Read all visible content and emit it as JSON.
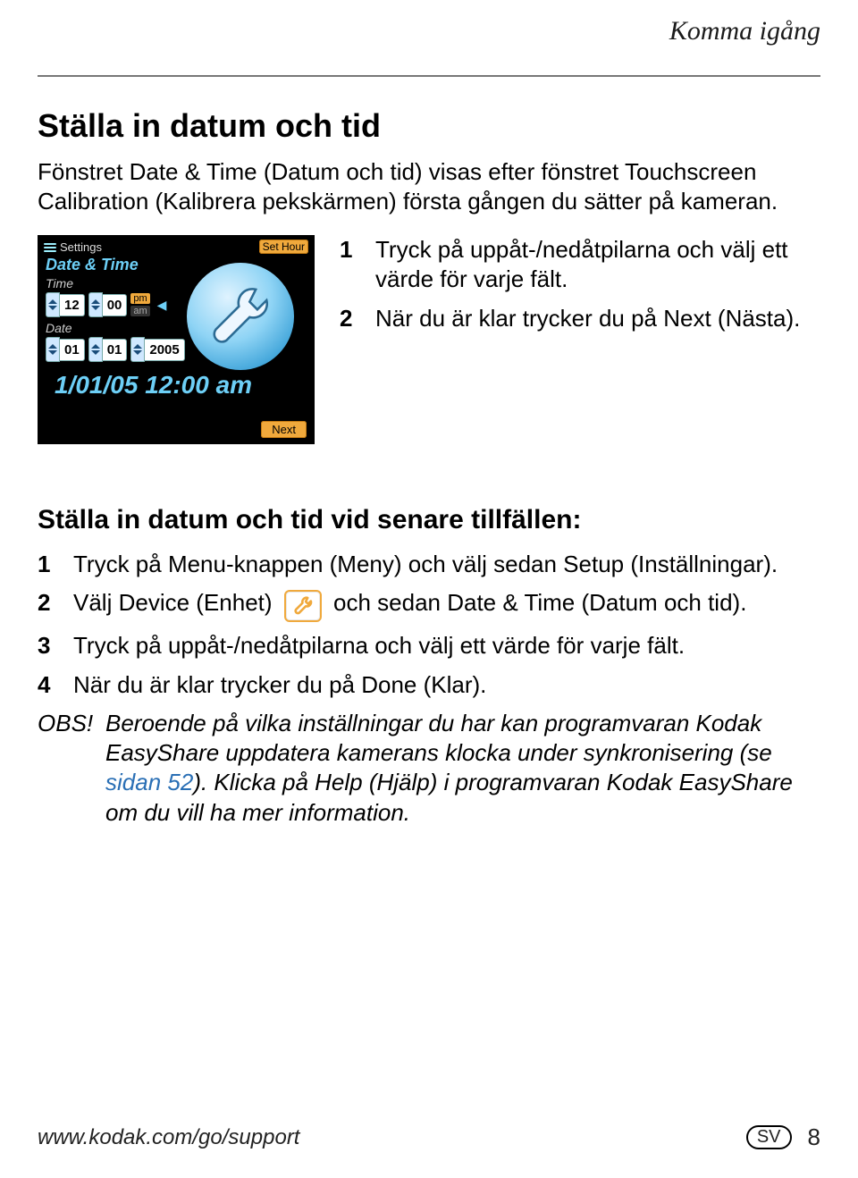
{
  "header": {
    "section_title": "Komma igång"
  },
  "h1": "Ställa in datum och tid",
  "intro": "Fönstret Date & Time (Datum och tid) visas efter fönstret Touchscreen Calibration (Kalibrera pekskärmen) första gången du sätter på kameran.",
  "screen": {
    "settings_label": "Settings",
    "set_hour_label": "Set Hour",
    "date_time_label": "Date & Time",
    "time_label": "Time",
    "hour_value": "12",
    "minute_value": "00",
    "pm_label": "pm",
    "am_label": "am",
    "date_label": "Date",
    "month_value": "01",
    "day_value": "01",
    "year_value": "2005",
    "big_line": "1/01/05 12:00 am",
    "next_label": "Next"
  },
  "steps_a": {
    "n1": "1",
    "t1": "Tryck på uppåt-/nedåtpilarna och välj ett värde för varje fält.",
    "n2": "2",
    "t2": "När du är klar trycker du på Next (Nästa)."
  },
  "h2": "Ställa in datum och tid vid senare tillfällen:",
  "steps_b": {
    "n1": "1",
    "t1": "Tryck på Menu-knappen (Meny) och välj sedan Setup (Inställningar).",
    "n2": "2",
    "t2a": "Välj Device (Enhet) ",
    "t2b": " och sedan Date & Time (Datum och tid).",
    "n3": "3",
    "t3": "Tryck på uppåt-/nedåtpilarna och välj ett värde för varje fält.",
    "n4": "4",
    "t4": "När du är klar trycker du på Done (Klar)."
  },
  "obs": {
    "label": "OBS!",
    "text_a": "Beroende på vilka inställningar du har kan programvaran Kodak EasyShare uppdatera kamerans klocka under synkronisering (se ",
    "link": "sidan 52",
    "text_b": "). Klicka på Help (Hjälp) i programvaran Kodak EasyShare om du vill ha mer information."
  },
  "footer": {
    "url": "www.kodak.com/go/support",
    "lang": "SV",
    "page": "8"
  }
}
